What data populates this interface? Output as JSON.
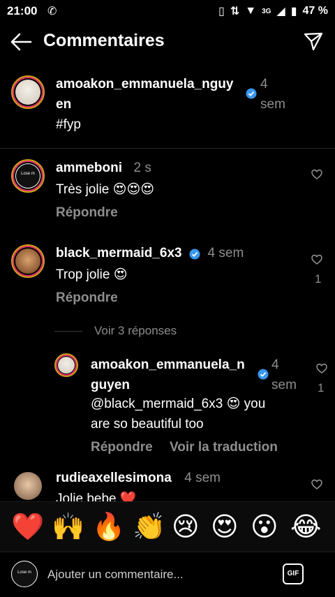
{
  "status_bar": {
    "time": "21:00",
    "battery": "47 %",
    "network": "3G"
  },
  "header": {
    "title": "Commentaires"
  },
  "caption": {
    "username_line1": "amoakon_emmanuela_nguy",
    "username_line2": "en",
    "time_line1": "4",
    "time_line2": "sem",
    "text": "#fyp"
  },
  "comments": [
    {
      "username": "ammeboni",
      "time": "2 s",
      "text": "Très jolie 😍😍😍",
      "reply": "Répondre",
      "avatar_text": "Lose m"
    },
    {
      "username": "black_mermaid_6x3",
      "time": "4 sem",
      "text": "Trop jolie 😍",
      "reply": "Répondre",
      "likes": "1",
      "view_replies": "Voir 3 réponses"
    },
    {
      "username_line1": "amoakon_emmanuela_n",
      "username_line2": "guyen",
      "time_line1": "4",
      "time_line2": "sem",
      "text_line1": "@black_mermaid_6x3 😍 you",
      "text_line2": "are so beautiful too",
      "reply": "Répondre",
      "translate": "Voir la traduction",
      "likes": "1"
    },
    {
      "username": "rudieaxellesimona",
      "time": "4 sem",
      "text": "Jolie bebe ❤️"
    }
  ],
  "emoji_bar": [
    "❤️",
    "🙌",
    "🔥",
    "👏",
    "😢",
    "😍",
    "😮",
    "😂"
  ],
  "composer": {
    "placeholder": "Ajouter un commentaire...",
    "gif_label": "GIF",
    "avatar_text": "Lose m"
  },
  "colors": {
    "background": "#000000",
    "secondary_text": "#8e8e8e",
    "verified": "#3897f0",
    "heart_red": "#ed4956"
  }
}
